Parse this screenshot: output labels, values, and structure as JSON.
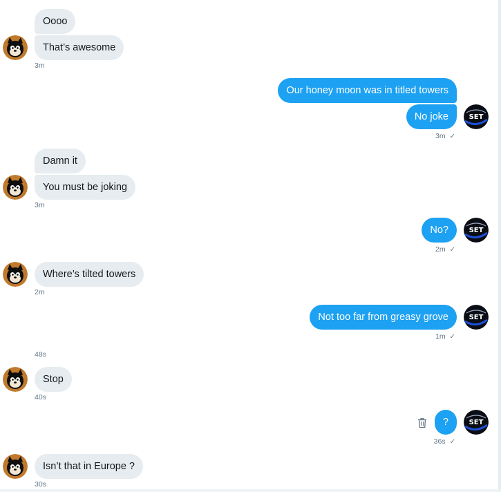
{
  "messages": [
    {
      "text": "Oooo"
    },
    {
      "text": "That’s awesome"
    },
    {
      "text": "Our honey moon was in titled towers"
    },
    {
      "text": "No joke"
    },
    {
      "text": "Damn it"
    },
    {
      "text": "You must be joking"
    },
    {
      "text": "No?"
    },
    {
      "text": "Where’s tilted towers"
    },
    {
      "text": "Not too far from greasy grove"
    },
    {
      "text": "Stop"
    },
    {
      "text": "?"
    },
    {
      "text": "Isn’t that in Europe ?"
    }
  ],
  "timestamps": {
    "t1": "3m",
    "t2": "3m",
    "t3": "3m",
    "t4": "2m",
    "t5": "2m",
    "t6": "1m",
    "t7": "48s",
    "t8": "40s",
    "t9": "36s",
    "t10": "30s"
  },
  "read_mark": "✓",
  "colors": {
    "incoming_bubble": "#e6ecf0",
    "outgoing_bubble": "#1da1f2",
    "meta_text": "#657786"
  },
  "icons": {
    "incoming_avatar": "cartoon-cat-avatar",
    "outgoing_avatar": "set-logo-avatar",
    "delete": "trash-icon",
    "read_receipt": "check-icon"
  }
}
